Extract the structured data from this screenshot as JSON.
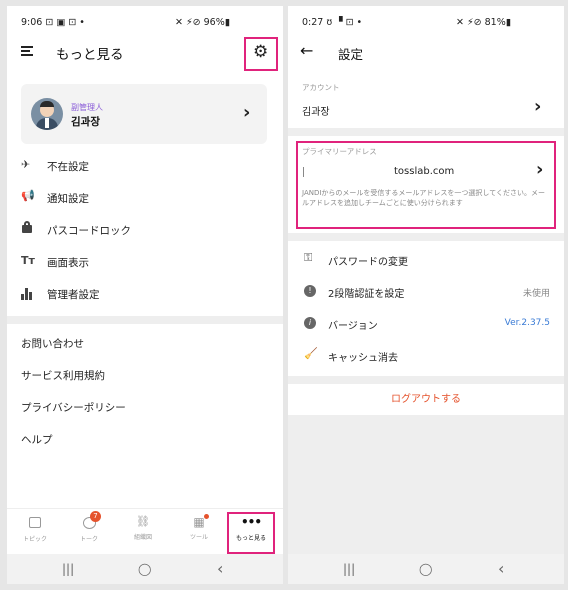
{
  "left": {
    "status": {
      "time": "9:06 ⊡ ▣ ⊡ •",
      "right": "✕ ⚡⊘ 96%▮"
    },
    "header": {
      "title": "もっと見る"
    },
    "profile": {
      "role": "副管理人",
      "name": "김과장"
    },
    "menu": [
      "不在設定",
      "通知設定",
      "パスコードロック",
      "画面表示",
      "管理者設定"
    ],
    "links": [
      "お問い合わせ",
      "サービス利用規約",
      "プライバシーポリシー",
      "ヘルプ"
    ],
    "tabs": [
      {
        "label": "トピック",
        "icon": "topic-icon"
      },
      {
        "label": "トーク",
        "icon": "talk-icon",
        "badge": "7"
      },
      {
        "label": "組織図",
        "icon": "org-chart-icon"
      },
      {
        "label": "ツール",
        "icon": "tools-icon"
      },
      {
        "label": "もっと見る",
        "icon": "more-icon"
      }
    ],
    "nav": {
      "recents": "|||",
      "home": "◯",
      "back": "‹"
    }
  },
  "right": {
    "status": {
      "time": "0:27 ʊ ▝ ⊡ •",
      "right": "✕ ⚡⊘ 81%▮"
    },
    "header": {
      "title": "設定"
    },
    "account": {
      "label": "アカウント",
      "value": "김과장"
    },
    "primary": {
      "label": "プライマリーアドレス",
      "email": "tosslab.com",
      "desc": "JANDIからのメールを受信するメールアドレスを一つ選択してください。メールアドレスを追加しチームごとに使い分けられます"
    },
    "settings": [
      {
        "label": "パスワードの変更",
        "value": "",
        "icon": "key-icon"
      },
      {
        "label": "2段階認証を設定",
        "value": "未使用",
        "icon": "shield-icon"
      },
      {
        "label": "バージョン",
        "value": "Ver.2.37.5",
        "icon": "info-icon"
      },
      {
        "label": "キャッシュ消去",
        "value": "",
        "icon": "broom-icon"
      }
    ],
    "logout": "ログアウトする",
    "nav": {
      "recents": "|||",
      "home": "◯",
      "back": "‹"
    }
  },
  "colors": {
    "accent": "#e0237c",
    "link": "#3a7bd5",
    "logout": "#e5532d",
    "role": "#8a5cd8"
  }
}
